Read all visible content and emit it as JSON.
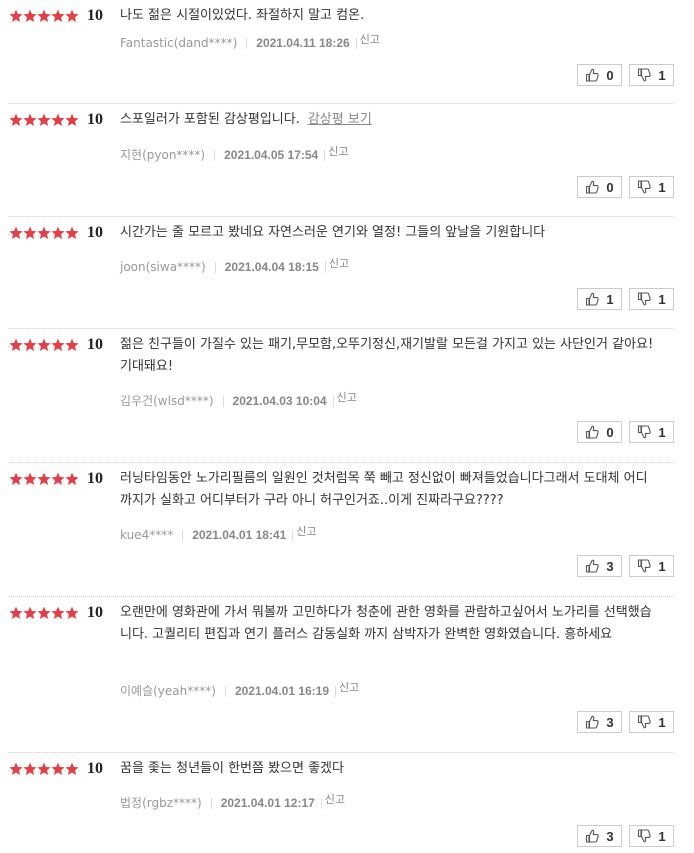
{
  "reviews": [
    {
      "score": "10",
      "text": "나도 젊은 시절이있었다. 좌절하지 말고 컴온.",
      "spoiler_link": "",
      "author": "Fantastic(dand****)",
      "date": "2021.04.11 18:26",
      "report": "신고",
      "likes": "0",
      "dislikes": "1"
    },
    {
      "score": "10",
      "text": "스포일러가 포함된 감상평입니다.",
      "spoiler_link": "감상평 보기",
      "author": "지현(pyon****)",
      "date": "2021.04.05 17:54",
      "report": "신고",
      "likes": "0",
      "dislikes": "1"
    },
    {
      "score": "10",
      "text": "시간가는 줄 모르고 봤네요 자연스러운 연기와 열정! 그들의 앞날을 기원합니다",
      "spoiler_link": "",
      "author": "joon(siwa****)",
      "date": "2021.04.04 18:15",
      "report": "신고",
      "likes": "1",
      "dislikes": "1"
    },
    {
      "score": "10",
      "text": "젊은 친구들이 가질수 있는 패기,무모함,오뚜기정신,재기발랄 모든걸 가지고 있는 사단인거 같아요!기대돼요!",
      "spoiler_link": "",
      "author": "김우건(wlsd****)",
      "date": "2021.04.03 10:04",
      "report": "신고",
      "likes": "0",
      "dislikes": "1"
    },
    {
      "score": "10",
      "text": "러닝타임동안 노가리필름의 일원인 것처럼목 쭉 빼고 정신없이 빠져들었습니다그래서 도대체 어디까지가 실화고 어디부터가 구라 아니 허구인거죠..이게 진짜라구요????",
      "spoiler_link": "",
      "author": "kue4****",
      "date": "2021.04.01 18:41",
      "report": "신고",
      "likes": "3",
      "dislikes": "1"
    },
    {
      "score": "10",
      "text": "오랜만에 영화관에 가서 뭐볼까 고민하다가 청춘에 관한 영화를 관람하고싶어서 노가리를 선택했습니다. 고퀄리티 편집과 연기 플러스 감동실화 까지 삼박자가 완벽한 영화였습니다. 흥하세요",
      "spoiler_link": "",
      "author": "이예슬(yeah****)",
      "date": "2021.04.01 16:19",
      "report": "신고",
      "likes": "3",
      "dislikes": "1"
    },
    {
      "score": "10",
      "text": "꿈을 좇는 청년들이 한번쯤 봤으면 좋겠다",
      "spoiler_link": "",
      "author": "법정(rgbz****)",
      "date": "2021.04.01 12:17",
      "report": "신고",
      "likes": "3",
      "dislikes": "1"
    }
  ],
  "colors": {
    "star": "#e43f47",
    "divider": "#cfcfcf",
    "meta_text": "#999999",
    "button_border": "#cccccc"
  },
  "icons": {
    "rating": "star-icon",
    "like": "thumbs-up-icon",
    "dislike": "thumbs-down-icon"
  }
}
